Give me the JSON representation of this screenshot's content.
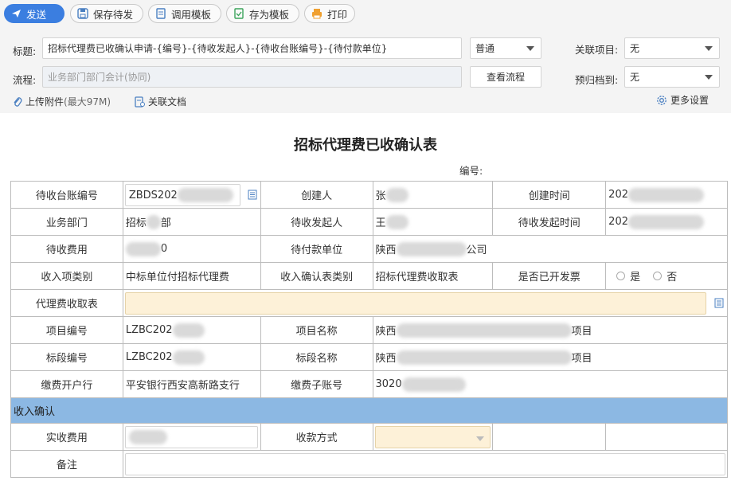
{
  "toolbar": {
    "send": "发送",
    "save_pending": "保存待发",
    "use_template": "调用模板",
    "save_template": "存为模板",
    "print": "打印"
  },
  "header": {
    "title_label": "标题:",
    "title_value": "招标代理费已收确认申请-{编号}-{待收发起人}-{待收台账编号}-{待付款单位}",
    "priority_value": "普通",
    "related_project_label": "关联项目:",
    "related_project_value": "无",
    "flow_label": "流程:",
    "flow_value": "业务部门部门会计(协同)",
    "view_flow_button": "查看流程",
    "archive_label": "预归档到:",
    "archive_value": "无",
    "upload_attachment": "上传附件",
    "upload_limit": "(最大97M)",
    "related_doc": "关联文档",
    "more_settings": "更多设置"
  },
  "form": {
    "title": "招标代理费已收确认表",
    "number_label": "编号:",
    "rows": {
      "r1": {
        "l1": "待收台账编号",
        "v1": "ZBDS202",
        "l2": "创建人",
        "v2": "张",
        "l3": "创建时间",
        "v3": "202"
      },
      "r2": {
        "l1": "业务部门",
        "v1a": "招标",
        "v1b": "部",
        "l2": "待收发起人",
        "v2": "王",
        "l3": "待收发起时间",
        "v3": "202"
      },
      "r3": {
        "l1": "待收费用",
        "v1": "0",
        "l2": "待付款单位",
        "v2a": "陕西",
        "v2b": "公司"
      },
      "r4": {
        "l1": "收入项类别",
        "v1": "中标单位付招标代理费",
        "l2": "收入确认表类别",
        "v2": "招标代理费收取表",
        "l3": "是否已开发票",
        "yes": "是",
        "no": "否"
      },
      "r5": {
        "l1": "代理费收取表"
      },
      "r6": {
        "l1": "项目编号",
        "v1": "LZBC202",
        "l2": "项目名称",
        "v2a": "陕西",
        "v2b": "项目"
      },
      "r7": {
        "l1": "标段编号",
        "v1": "LZBC202",
        "l2": "标段名称",
        "v2a": "陕西",
        "v2b": "项目"
      },
      "r8": {
        "l1": "缴费开户行",
        "v1": "平安银行西安高新路支行",
        "l2": "缴费子账号",
        "v2": "3020"
      },
      "section": "收入确认",
      "r9": {
        "l1": "实收费用",
        "l2": "收款方式"
      },
      "r10": {
        "l1": "备注"
      }
    }
  }
}
